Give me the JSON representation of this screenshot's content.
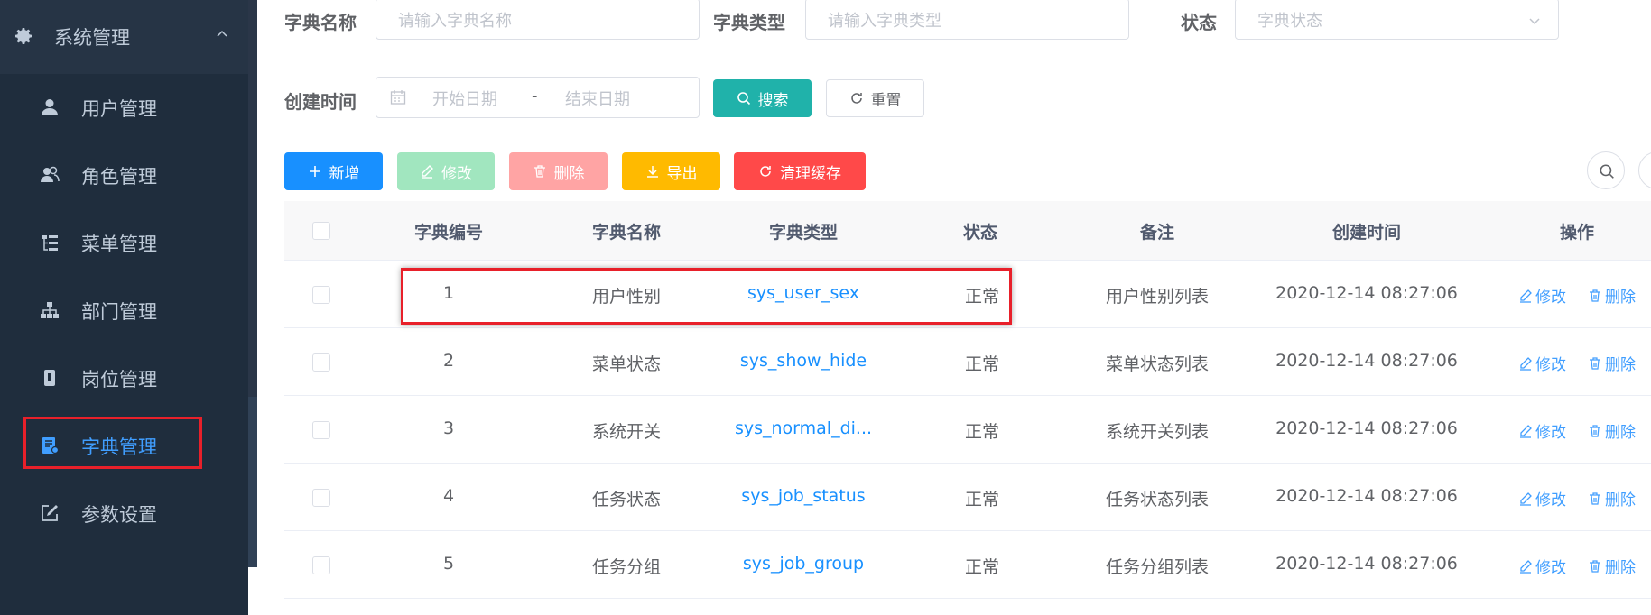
{
  "sidebar": {
    "group": {
      "label": "系统管理",
      "icon": "gear-icon"
    },
    "items": [
      {
        "label": "用户管理",
        "icon": "user-icon"
      },
      {
        "label": "角色管理",
        "icon": "peoples-icon"
      },
      {
        "label": "菜单管理",
        "icon": "tree-table-icon"
      },
      {
        "label": "部门管理",
        "icon": "tree-icon"
      },
      {
        "label": "岗位管理",
        "icon": "post-icon"
      },
      {
        "label": "字典管理",
        "icon": "dict-icon"
      },
      {
        "label": "参数设置",
        "icon": "edit-icon"
      }
    ]
  },
  "search": {
    "dict_name_label": "字典名称",
    "dict_name_placeholder": "请输入字典名称",
    "dict_type_label": "字典类型",
    "dict_type_placeholder": "请输入字典类型",
    "status_label": "状态",
    "status_placeholder": "字典状态",
    "created_label": "创建时间",
    "start_placeholder": "开始日期",
    "range_separator": "-",
    "end_placeholder": "结束日期",
    "search_button": "搜索",
    "reset_button": "重置"
  },
  "toolbar": {
    "add": "新增",
    "edit": "修改",
    "delete": "删除",
    "export": "导出",
    "clear_cache": "清理缓存"
  },
  "colors": {
    "primary": "#1890ff",
    "success": "#13ce66",
    "danger": "#ff4949",
    "warning": "#ffba00",
    "teal": "#20b2aa",
    "sidebar_bg": "#304156",
    "highlight": "#e8202a"
  },
  "table": {
    "columns": [
      "字典编号",
      "字典名称",
      "字典类型",
      "状态",
      "备注",
      "创建时间",
      "操作"
    ],
    "rows": [
      {
        "id": "1",
        "name": "用户性别",
        "type": "sys_user_sex",
        "status": "正常",
        "remark": "用户性别列表",
        "created": "2020-12-14 08:27:06"
      },
      {
        "id": "2",
        "name": "菜单状态",
        "type": "sys_show_hide",
        "status": "正常",
        "remark": "菜单状态列表",
        "created": "2020-12-14 08:27:06"
      },
      {
        "id": "3",
        "name": "系统开关",
        "type": "sys_normal_di...",
        "status": "正常",
        "remark": "系统开关列表",
        "created": "2020-12-14 08:27:06"
      },
      {
        "id": "4",
        "name": "任务状态",
        "type": "sys_job_status",
        "status": "正常",
        "remark": "任务状态列表",
        "created": "2020-12-14 08:27:06"
      },
      {
        "id": "5",
        "name": "任务分组",
        "type": "sys_job_group",
        "status": "正常",
        "remark": "任务分组列表",
        "created": "2020-12-14 08:27:06"
      }
    ],
    "row_actions": {
      "edit": "修改",
      "delete": "删除"
    }
  }
}
